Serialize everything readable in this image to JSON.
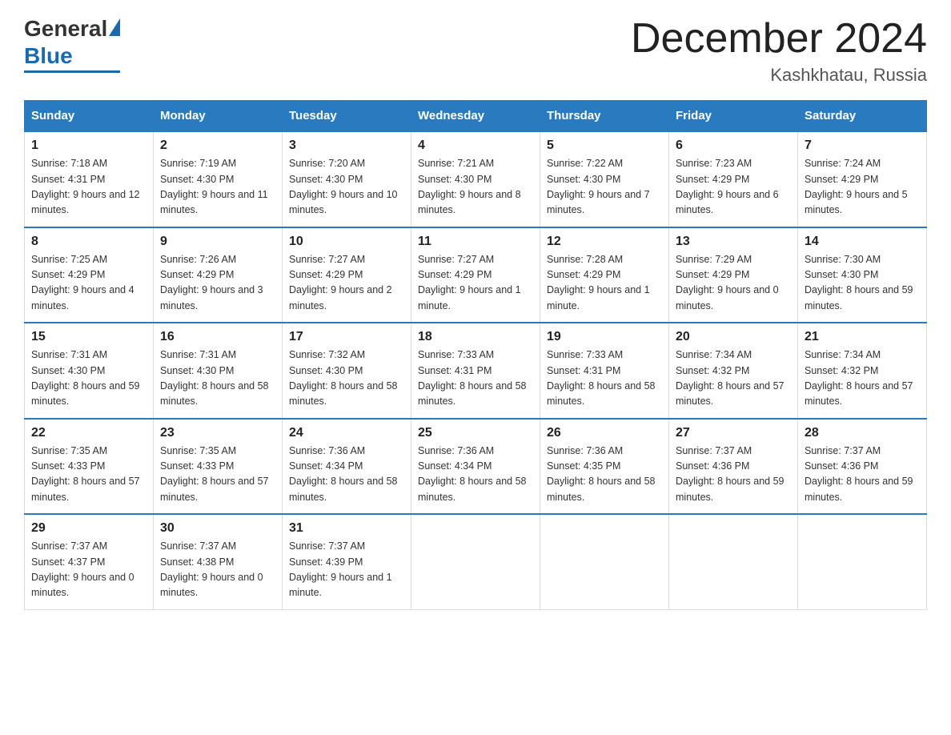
{
  "header": {
    "logo_general": "General",
    "logo_blue": "Blue",
    "month_title": "December 2024",
    "location": "Kashkhatau, Russia"
  },
  "days_of_week": [
    "Sunday",
    "Monday",
    "Tuesday",
    "Wednesday",
    "Thursday",
    "Friday",
    "Saturday"
  ],
  "weeks": [
    [
      {
        "day": "1",
        "sunrise": "7:18 AM",
        "sunset": "4:31 PM",
        "daylight": "9 hours and 12 minutes."
      },
      {
        "day": "2",
        "sunrise": "7:19 AM",
        "sunset": "4:30 PM",
        "daylight": "9 hours and 11 minutes."
      },
      {
        "day": "3",
        "sunrise": "7:20 AM",
        "sunset": "4:30 PM",
        "daylight": "9 hours and 10 minutes."
      },
      {
        "day": "4",
        "sunrise": "7:21 AM",
        "sunset": "4:30 PM",
        "daylight": "9 hours and 8 minutes."
      },
      {
        "day": "5",
        "sunrise": "7:22 AM",
        "sunset": "4:30 PM",
        "daylight": "9 hours and 7 minutes."
      },
      {
        "day": "6",
        "sunrise": "7:23 AM",
        "sunset": "4:29 PM",
        "daylight": "9 hours and 6 minutes."
      },
      {
        "day": "7",
        "sunrise": "7:24 AM",
        "sunset": "4:29 PM",
        "daylight": "9 hours and 5 minutes."
      }
    ],
    [
      {
        "day": "8",
        "sunrise": "7:25 AM",
        "sunset": "4:29 PM",
        "daylight": "9 hours and 4 minutes."
      },
      {
        "day": "9",
        "sunrise": "7:26 AM",
        "sunset": "4:29 PM",
        "daylight": "9 hours and 3 minutes."
      },
      {
        "day": "10",
        "sunrise": "7:27 AM",
        "sunset": "4:29 PM",
        "daylight": "9 hours and 2 minutes."
      },
      {
        "day": "11",
        "sunrise": "7:27 AM",
        "sunset": "4:29 PM",
        "daylight": "9 hours and 1 minute."
      },
      {
        "day": "12",
        "sunrise": "7:28 AM",
        "sunset": "4:29 PM",
        "daylight": "9 hours and 1 minute."
      },
      {
        "day": "13",
        "sunrise": "7:29 AM",
        "sunset": "4:29 PM",
        "daylight": "9 hours and 0 minutes."
      },
      {
        "day": "14",
        "sunrise": "7:30 AM",
        "sunset": "4:30 PM",
        "daylight": "8 hours and 59 minutes."
      }
    ],
    [
      {
        "day": "15",
        "sunrise": "7:31 AM",
        "sunset": "4:30 PM",
        "daylight": "8 hours and 59 minutes."
      },
      {
        "day": "16",
        "sunrise": "7:31 AM",
        "sunset": "4:30 PM",
        "daylight": "8 hours and 58 minutes."
      },
      {
        "day": "17",
        "sunrise": "7:32 AM",
        "sunset": "4:30 PM",
        "daylight": "8 hours and 58 minutes."
      },
      {
        "day": "18",
        "sunrise": "7:33 AM",
        "sunset": "4:31 PM",
        "daylight": "8 hours and 58 minutes."
      },
      {
        "day": "19",
        "sunrise": "7:33 AM",
        "sunset": "4:31 PM",
        "daylight": "8 hours and 58 minutes."
      },
      {
        "day": "20",
        "sunrise": "7:34 AM",
        "sunset": "4:32 PM",
        "daylight": "8 hours and 57 minutes."
      },
      {
        "day": "21",
        "sunrise": "7:34 AM",
        "sunset": "4:32 PM",
        "daylight": "8 hours and 57 minutes."
      }
    ],
    [
      {
        "day": "22",
        "sunrise": "7:35 AM",
        "sunset": "4:33 PM",
        "daylight": "8 hours and 57 minutes."
      },
      {
        "day": "23",
        "sunrise": "7:35 AM",
        "sunset": "4:33 PM",
        "daylight": "8 hours and 57 minutes."
      },
      {
        "day": "24",
        "sunrise": "7:36 AM",
        "sunset": "4:34 PM",
        "daylight": "8 hours and 58 minutes."
      },
      {
        "day": "25",
        "sunrise": "7:36 AM",
        "sunset": "4:34 PM",
        "daylight": "8 hours and 58 minutes."
      },
      {
        "day": "26",
        "sunrise": "7:36 AM",
        "sunset": "4:35 PM",
        "daylight": "8 hours and 58 minutes."
      },
      {
        "day": "27",
        "sunrise": "7:37 AM",
        "sunset": "4:36 PM",
        "daylight": "8 hours and 59 minutes."
      },
      {
        "day": "28",
        "sunrise": "7:37 AM",
        "sunset": "4:36 PM",
        "daylight": "8 hours and 59 minutes."
      }
    ],
    [
      {
        "day": "29",
        "sunrise": "7:37 AM",
        "sunset": "4:37 PM",
        "daylight": "9 hours and 0 minutes."
      },
      {
        "day": "30",
        "sunrise": "7:37 AM",
        "sunset": "4:38 PM",
        "daylight": "9 hours and 0 minutes."
      },
      {
        "day": "31",
        "sunrise": "7:37 AM",
        "sunset": "4:39 PM",
        "daylight": "9 hours and 1 minute."
      },
      null,
      null,
      null,
      null
    ]
  ]
}
